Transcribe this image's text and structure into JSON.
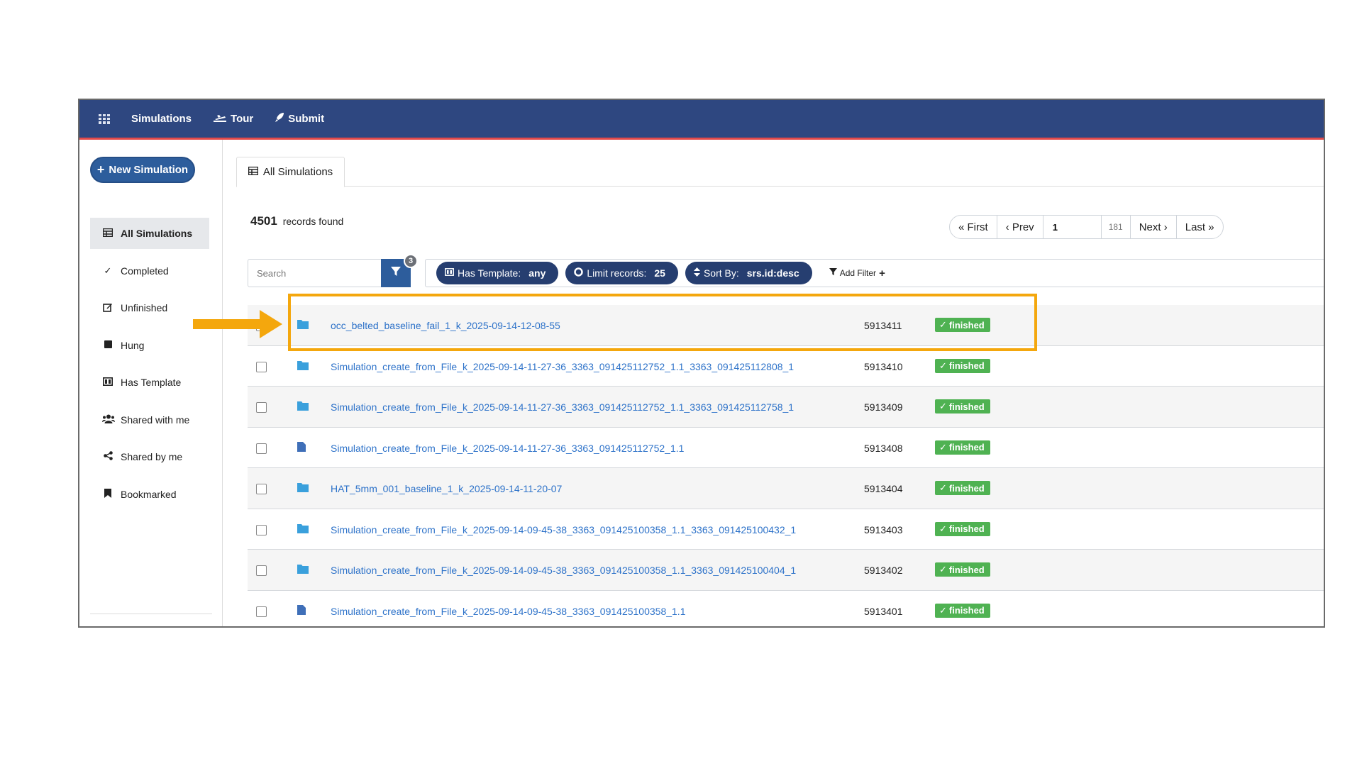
{
  "colors": {
    "topbar": "#2e4780",
    "accent": "#2d5d9c",
    "chip": "#263e70",
    "link": "#2d72c9",
    "status_ok": "#4fb252",
    "highlight": "#f4a70d"
  },
  "topnav": {
    "app_icon": "grid-icon",
    "items": [
      {
        "label": "Simulations",
        "icon": ""
      },
      {
        "label": "Tour",
        "icon": "plane-icon"
      },
      {
        "label": "Submit",
        "icon": "rocket-icon"
      }
    ]
  },
  "sidebar": {
    "new_button": "New Simulation",
    "items": [
      {
        "label": "All Simulations",
        "icon": "table-icon",
        "active": true
      },
      {
        "label": "Completed",
        "icon": "check-icon"
      },
      {
        "label": "Unfinished",
        "icon": "edit-icon"
      },
      {
        "label": "Hung",
        "icon": "stop-icon"
      },
      {
        "label": "Has Template",
        "icon": "template-icon"
      },
      {
        "label": "Shared with me",
        "icon": "users-icon"
      },
      {
        "label": "Shared by me",
        "icon": "share-icon"
      },
      {
        "label": "Bookmarked",
        "icon": "bookmark-icon"
      }
    ]
  },
  "tab": {
    "label": "All Simulations"
  },
  "records": {
    "count": "4501",
    "suffix": "records found"
  },
  "pager": {
    "first": "« First",
    "prev": "‹ Prev",
    "page": "1",
    "total": "181",
    "next": "Next ›",
    "last": "Last »"
  },
  "filters": {
    "search_placeholder": "Search",
    "active_count": "3",
    "chips": [
      {
        "label": "Has Template:",
        "value": "any",
        "icon": "template-icon"
      },
      {
        "label": "Limit records:",
        "value": "25",
        "icon": "circle-icon"
      },
      {
        "label": "Sort By:",
        "value": "srs.id:desc",
        "icon": "sort-icon"
      }
    ],
    "add_filter": "Add Filter"
  },
  "rows": [
    {
      "name": "occ_belted_baseline_fail_1_k_2025-09-14-12-08-55",
      "id": "5913411",
      "status": "finished",
      "type": "folder"
    },
    {
      "name": "Simulation_create_from_File_k_2025-09-14-11-27-36_3363_091425112752_1.1_3363_091425112808_1",
      "id": "5913410",
      "status": "finished",
      "type": "folder"
    },
    {
      "name": "Simulation_create_from_File_k_2025-09-14-11-27-36_3363_091425112752_1.1_3363_091425112758_1",
      "id": "5913409",
      "status": "finished",
      "type": "folder"
    },
    {
      "name": "Simulation_create_from_File_k_2025-09-14-11-27-36_3363_091425112752_1.1",
      "id": "5913408",
      "status": "finished",
      "type": "file"
    },
    {
      "name": "HAT_5mm_001_baseline_1_k_2025-09-14-11-20-07",
      "id": "5913404",
      "status": "finished",
      "type": "folder"
    },
    {
      "name": "Simulation_create_from_File_k_2025-09-14-09-45-38_3363_091425100358_1.1_3363_091425100432_1",
      "id": "5913403",
      "status": "finished",
      "type": "folder"
    },
    {
      "name": "Simulation_create_from_File_k_2025-09-14-09-45-38_3363_091425100358_1.1_3363_091425100404_1",
      "id": "5913402",
      "status": "finished",
      "type": "folder"
    },
    {
      "name": "Simulation_create_from_File_k_2025-09-14-09-45-38_3363_091425100358_1.1",
      "id": "5913401",
      "status": "finished",
      "type": "file"
    }
  ]
}
